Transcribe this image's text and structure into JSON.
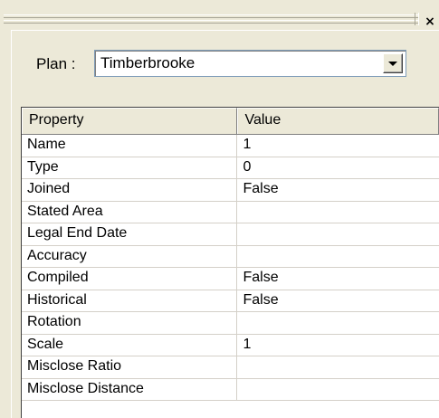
{
  "window": {
    "close_glyph": "×"
  },
  "plan": {
    "label": "Plan :",
    "selected": "Timberbrooke"
  },
  "grid": {
    "headers": [
      "Property",
      "Value"
    ],
    "rows": [
      {
        "property": "Name",
        "value": "1"
      },
      {
        "property": "Type",
        "value": "0"
      },
      {
        "property": "Joined",
        "value": "False"
      },
      {
        "property": "Stated Area",
        "value": ""
      },
      {
        "property": "Legal End Date",
        "value": ""
      },
      {
        "property": "Accuracy",
        "value": ""
      },
      {
        "property": "Compiled",
        "value": "False"
      },
      {
        "property": "Historical",
        "value": "False"
      },
      {
        "property": "Rotation",
        "value": ""
      },
      {
        "property": "Scale",
        "value": "1"
      },
      {
        "property": "Misclose Ratio",
        "value": ""
      },
      {
        "property": "Misclose Distance",
        "value": ""
      }
    ]
  },
  "colors": {
    "panel_bg": "#ece9d8",
    "grid_bg": "#ffffff",
    "grid_line": "#d4d0c8"
  },
  "icons": {
    "close": "close-icon",
    "dropdown": "chevron-down-icon",
    "gripper": "gripper-icon"
  }
}
